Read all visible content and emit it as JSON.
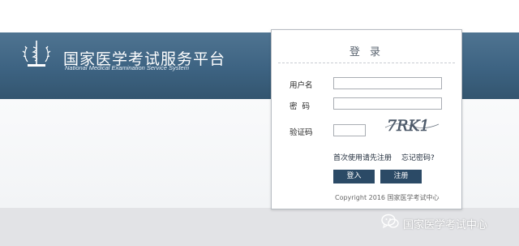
{
  "header": {
    "title": "国家医学考试服务平台",
    "subtitle": "National Medical Examination Service System"
  },
  "login": {
    "title": "登 录",
    "username_label": "用户名",
    "username_value": "",
    "password_label": "密  码",
    "password_value": "",
    "captcha_label": "验证码",
    "captcha_value": "",
    "captcha_text": "7RK1",
    "first_use_link": "首次使用请先注册",
    "forgot_link": "忘记密码?",
    "login_button": "登入",
    "register_button": "注册",
    "copyright": "Copyright 2016 国家医学考试中心"
  },
  "watermark": {
    "text": "国家医学考试中心"
  },
  "colors": {
    "header_blue": "#3d6382",
    "button_navy": "#2b4a66"
  }
}
